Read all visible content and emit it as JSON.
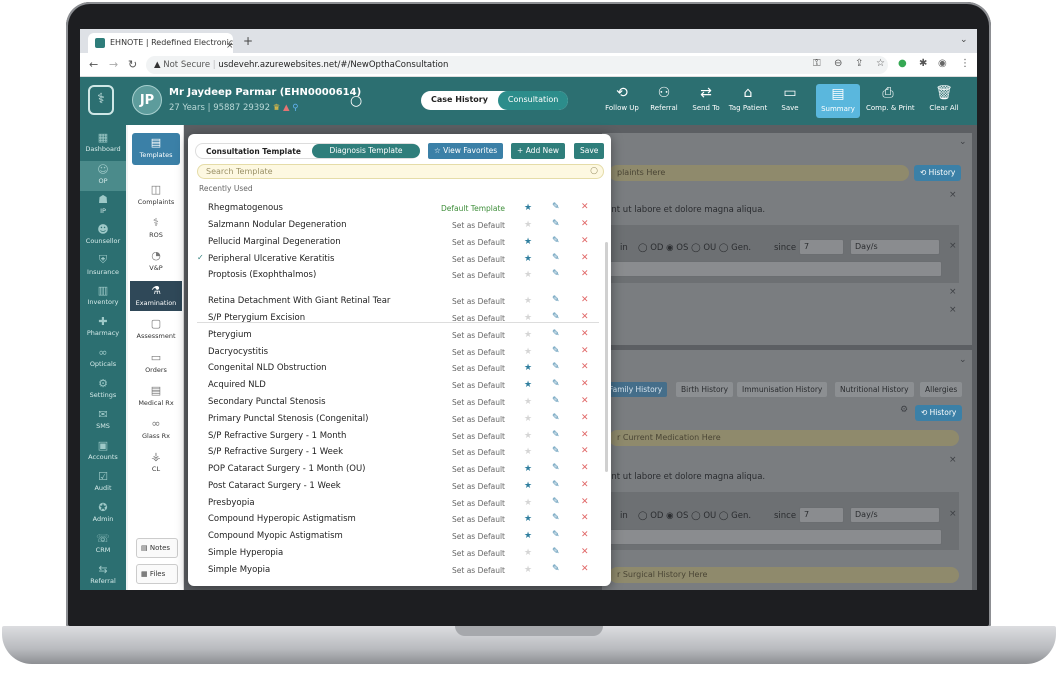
{
  "browser": {
    "tab_title": "EHNOTE | Redefined Electronic",
    "close": "×",
    "new_tab": "+",
    "chevron": "⌄",
    "not_secure": "Not Secure",
    "url": "usdevehr.azurewebsites.net/#/NewOpthaConsultation"
  },
  "header": {
    "avatar_initials": "JP",
    "patient_name": "Mr Jaydeep Parmar (EHN0000614)",
    "patient_info": "27 Years | 95887 29392",
    "case_history": "Case History",
    "consultation": "Consultation",
    "buttons": [
      {
        "label": "Follow Up",
        "icon": "follow-up"
      },
      {
        "label": "Referral",
        "icon": "referral"
      },
      {
        "label": "Send To",
        "icon": "send-to"
      },
      {
        "label": "Tag Patient",
        "icon": "tag"
      },
      {
        "label": "Save",
        "icon": "save"
      },
      {
        "label": "Summary",
        "icon": "summary"
      },
      {
        "label": "Comp. & Print",
        "icon": "print"
      },
      {
        "label": "Clear All",
        "icon": "trash"
      }
    ]
  },
  "sidebar": {
    "items": [
      {
        "label": "Dashboard"
      },
      {
        "label": "OP"
      },
      {
        "label": "IP"
      },
      {
        "label": "Counsellor"
      },
      {
        "label": "Insurance"
      },
      {
        "label": "Inventory"
      },
      {
        "label": "Pharmacy"
      },
      {
        "label": "Opticals"
      },
      {
        "label": "Settings"
      },
      {
        "label": "SMS"
      },
      {
        "label": "Accounts"
      },
      {
        "label": "Audit"
      },
      {
        "label": "Admin"
      },
      {
        "label": "CRM"
      },
      {
        "label": "Referral"
      }
    ]
  },
  "subsidebar": {
    "items": [
      {
        "label": "Templates"
      },
      {
        "label": "Complaints"
      },
      {
        "label": "ROS"
      },
      {
        "label": "V&P"
      },
      {
        "label": "Examination"
      },
      {
        "label": "Assessment"
      },
      {
        "label": "Orders"
      },
      {
        "label": "Medical Rx"
      },
      {
        "label": "Glass Rx"
      },
      {
        "label": "CL"
      }
    ],
    "notes": "Notes",
    "files": "Files"
  },
  "background": {
    "complaints_placeholder": "plaints Here",
    "history_btn": "History",
    "lorem": "unt ut labore et dolore magna aliqua.",
    "in_label": "in",
    "eye_options": [
      "OD",
      "OS",
      "OU",
      "Gen."
    ],
    "since_label": "since",
    "since_value": "7",
    "unit_value": "Day/s",
    "history_tabs": [
      "Family History",
      "Birth History",
      "Immunisation History",
      "Nutritional History",
      "Allergies"
    ],
    "medication_placeholder": "r Current Medication Here",
    "surgical_placeholder": "r Surgical History Here"
  },
  "modal": {
    "tab_consultation": "Consultation Template",
    "tab_diagnosis": "Diagnosis Template",
    "view_favorites": "View Favorites",
    "add_new": "Add New",
    "save": "Save",
    "search_placeholder": "Search Template",
    "recently_used": "Recently Used",
    "templates": [
      {
        "name": "Rhegmatogenous",
        "default": "Default Template",
        "fav": true,
        "checked": false
      },
      {
        "name": "Salzmann Nodular Degeneration",
        "default": "Set as Default",
        "fav": false,
        "checked": false
      },
      {
        "name": "Pellucid Marginal Degeneration",
        "default": "Set as Default",
        "fav": true,
        "checked": false
      },
      {
        "name": "Peripheral Ulcerative Keratitis",
        "default": "Set as Default",
        "fav": true,
        "checked": true
      },
      {
        "name": "Proptosis (Exophthalmos)",
        "default": "Set as Default",
        "fav": false,
        "checked": false
      },
      {
        "name": "Retina Detachment With Giant Retinal Tear",
        "default": "Set as Default",
        "fav": false,
        "checked": false
      },
      {
        "name": "S/P Pterygium Excision",
        "default": "Set as Default",
        "fav": false,
        "checked": false
      },
      {
        "name": "Pterygium",
        "default": "Set as Default",
        "fav": false,
        "checked": false
      },
      {
        "name": "Dacryocystitis",
        "default": "Set as Default",
        "fav": false,
        "checked": false
      },
      {
        "name": "Congenital NLD Obstruction",
        "default": "Set as Default",
        "fav": true,
        "checked": false
      },
      {
        "name": "Acquired NLD",
        "default": "Set as Default",
        "fav": true,
        "checked": false
      },
      {
        "name": "Secondary Punctal Stenosis",
        "default": "Set as Default",
        "fav": false,
        "checked": false
      },
      {
        "name": "Primary Punctal Stenosis (Congenital)",
        "default": "Set as Default",
        "fav": false,
        "checked": false
      },
      {
        "name": "S/P Refractive Surgery - 1 Month",
        "default": "Set as Default",
        "fav": false,
        "checked": false
      },
      {
        "name": "S/P Refractive Surgery - 1 Week",
        "default": "Set as Default",
        "fav": false,
        "checked": false
      },
      {
        "name": "POP Cataract Surgery - 1 Month (OU)",
        "default": "Set as Default",
        "fav": true,
        "checked": false
      },
      {
        "name": "Post Cataract Surgery - 1 Week",
        "default": "Set as Default",
        "fav": true,
        "checked": false
      },
      {
        "name": "Presbyopia",
        "default": "Set as Default",
        "fav": false,
        "checked": false
      },
      {
        "name": "Compound Hyperopic Astigmatism",
        "default": "Set as Default",
        "fav": true,
        "checked": false
      },
      {
        "name": "Compound Myopic Astigmatism",
        "default": "Set as Default",
        "fav": true,
        "checked": false
      },
      {
        "name": "Simple Hyperopia",
        "default": "Set as Default",
        "fav": false,
        "checked": false
      },
      {
        "name": "Simple Myopia",
        "default": "Set as Default",
        "fav": false,
        "checked": false
      }
    ]
  }
}
